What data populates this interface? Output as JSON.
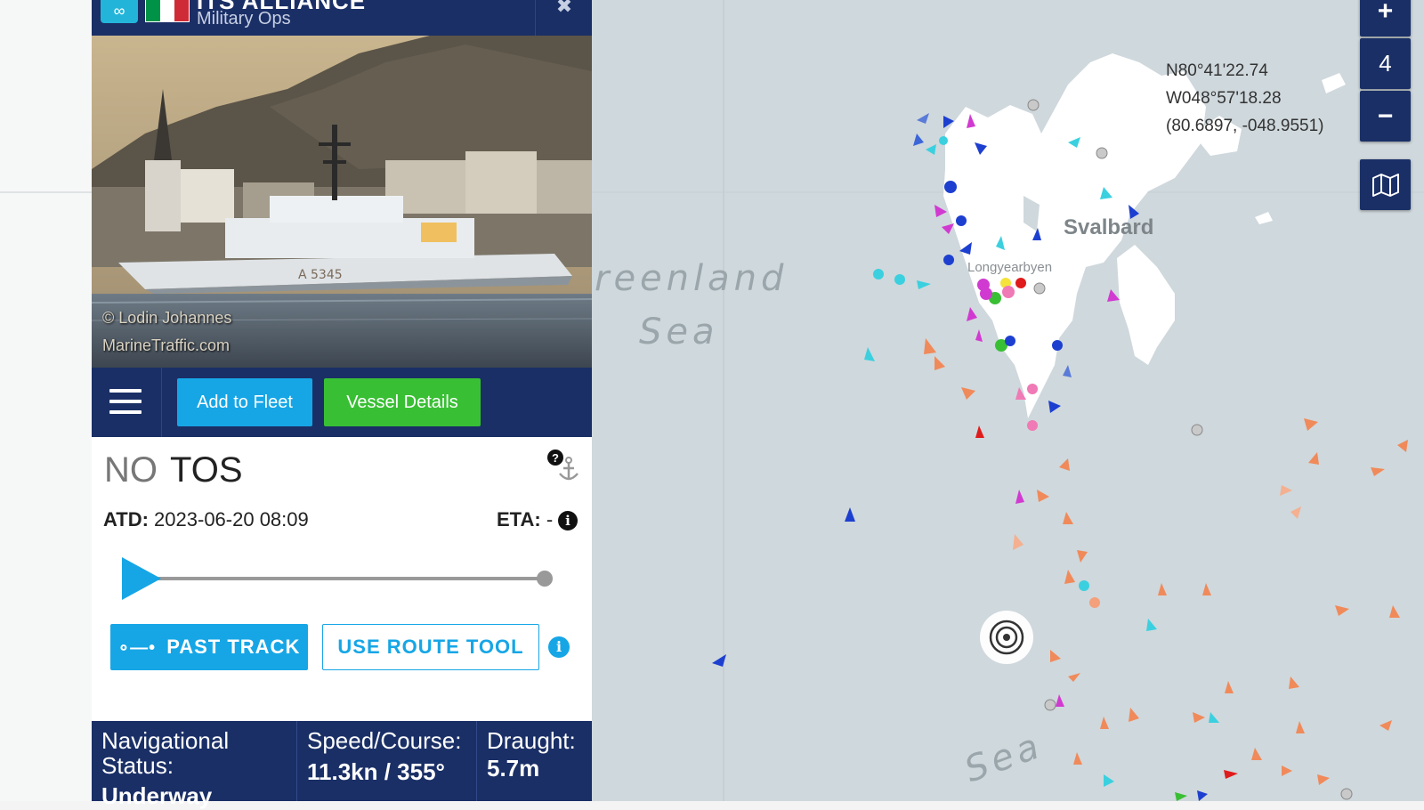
{
  "header": {
    "vessel_name": "ITS ALLIANCE",
    "vessel_type": "Military Ops",
    "link_icon": "chain-link-icon",
    "flag": "italy-flag",
    "flag_colors": [
      "#009246",
      "#ffffff",
      "#ce2b37"
    ],
    "close_icon": "close-icon"
  },
  "photo": {
    "credit_line1": "© Lodin Johannes",
    "credit_line2": "MarineTraffic.com",
    "hull_number": "A 5345"
  },
  "toolbar": {
    "menu_icon": "hamburger-menu-icon",
    "add_to_fleet": "Add to Fleet",
    "vessel_details": "Vessel Details"
  },
  "voyage": {
    "destination_prefix": "NO",
    "destination": "TOS",
    "anchor_icon": "anchor-help-icon",
    "atd_label": "ATD:",
    "atd_value": "2023-06-20 08:09",
    "eta_label": "ETA:",
    "eta_value": "-",
    "progress": 0.0,
    "past_track": "PAST TRACK",
    "use_route_tool": "USE ROUTE TOOL"
  },
  "status_bar": {
    "nav_status_label_1": "Navigational",
    "nav_status_label_2": "Status:",
    "nav_status_value": "Underway",
    "speed_label": "Speed/Course:",
    "speed_value": "11.3kn / 355°",
    "draught_label": "Draught:",
    "draught_value": "5.7m"
  },
  "map": {
    "sea_label_1a": "reenland",
    "sea_label_1b": "Sea",
    "sea_label_2": "Sea",
    "land_label": "Svalbard",
    "town_label": "Longyearbyen",
    "coord_lat": "N80°41'22.74",
    "coord_lon": "W048°57'18.28",
    "coord_decimal": "(80.6897, -048.9551)",
    "zoom_in": "+",
    "zoom_level": "4",
    "zoom_out": "−",
    "layers_icon": "map-layers-icon",
    "colors": {
      "sea": "#cfd8dc",
      "land": "#ffffff",
      "panel_navy": "#1a2f66",
      "accent_blue": "#16a6e6",
      "accent_green": "#39bf34"
    }
  }
}
